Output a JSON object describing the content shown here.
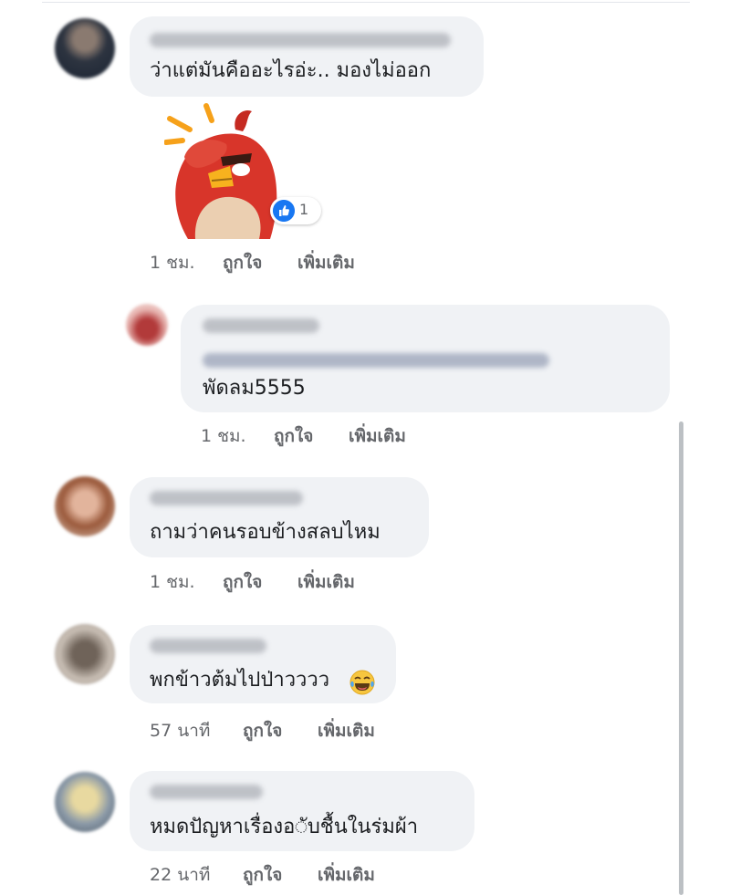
{
  "comments": [
    {
      "text": "ว่าแต่มันคืออะไรอ่ะ.. มองไม่ออก",
      "reaction_count": "1",
      "time": "1 ชม.",
      "like": "ถูกใจ",
      "more": "เพิ่มเติม"
    },
    {
      "reply": true,
      "text": "พัดลม5555",
      "time": "1 ชม.",
      "like": "ถูกใจ",
      "more": "เพิ่มเติม"
    },
    {
      "text": "ถามว่าคนรอบข้างสลบไหม",
      "time": "1 ชม.",
      "like": "ถูกใจ",
      "more": "เพิ่มเติม"
    },
    {
      "text": "พกข้าวต้มไปป่าวววว",
      "emoji": "tears-of-joy-emoji",
      "time": "57 นาที",
      "like": "ถูกใจ",
      "more": "เพิ่มเติม"
    },
    {
      "text": "หมดปัญหาเรื่องอ◌ับชื้นในร่มผ้า",
      "time": "22 นาที",
      "like": "ถูกใจ",
      "more": "เพิ่มเติม"
    }
  ],
  "icons": {
    "sticker": "angry-bird-facepalm-sticker",
    "reaction": "like-icon"
  },
  "colors": {
    "bubble": "#f0f2f5",
    "meta": "#65676b",
    "like_blue": "#1877f2"
  }
}
